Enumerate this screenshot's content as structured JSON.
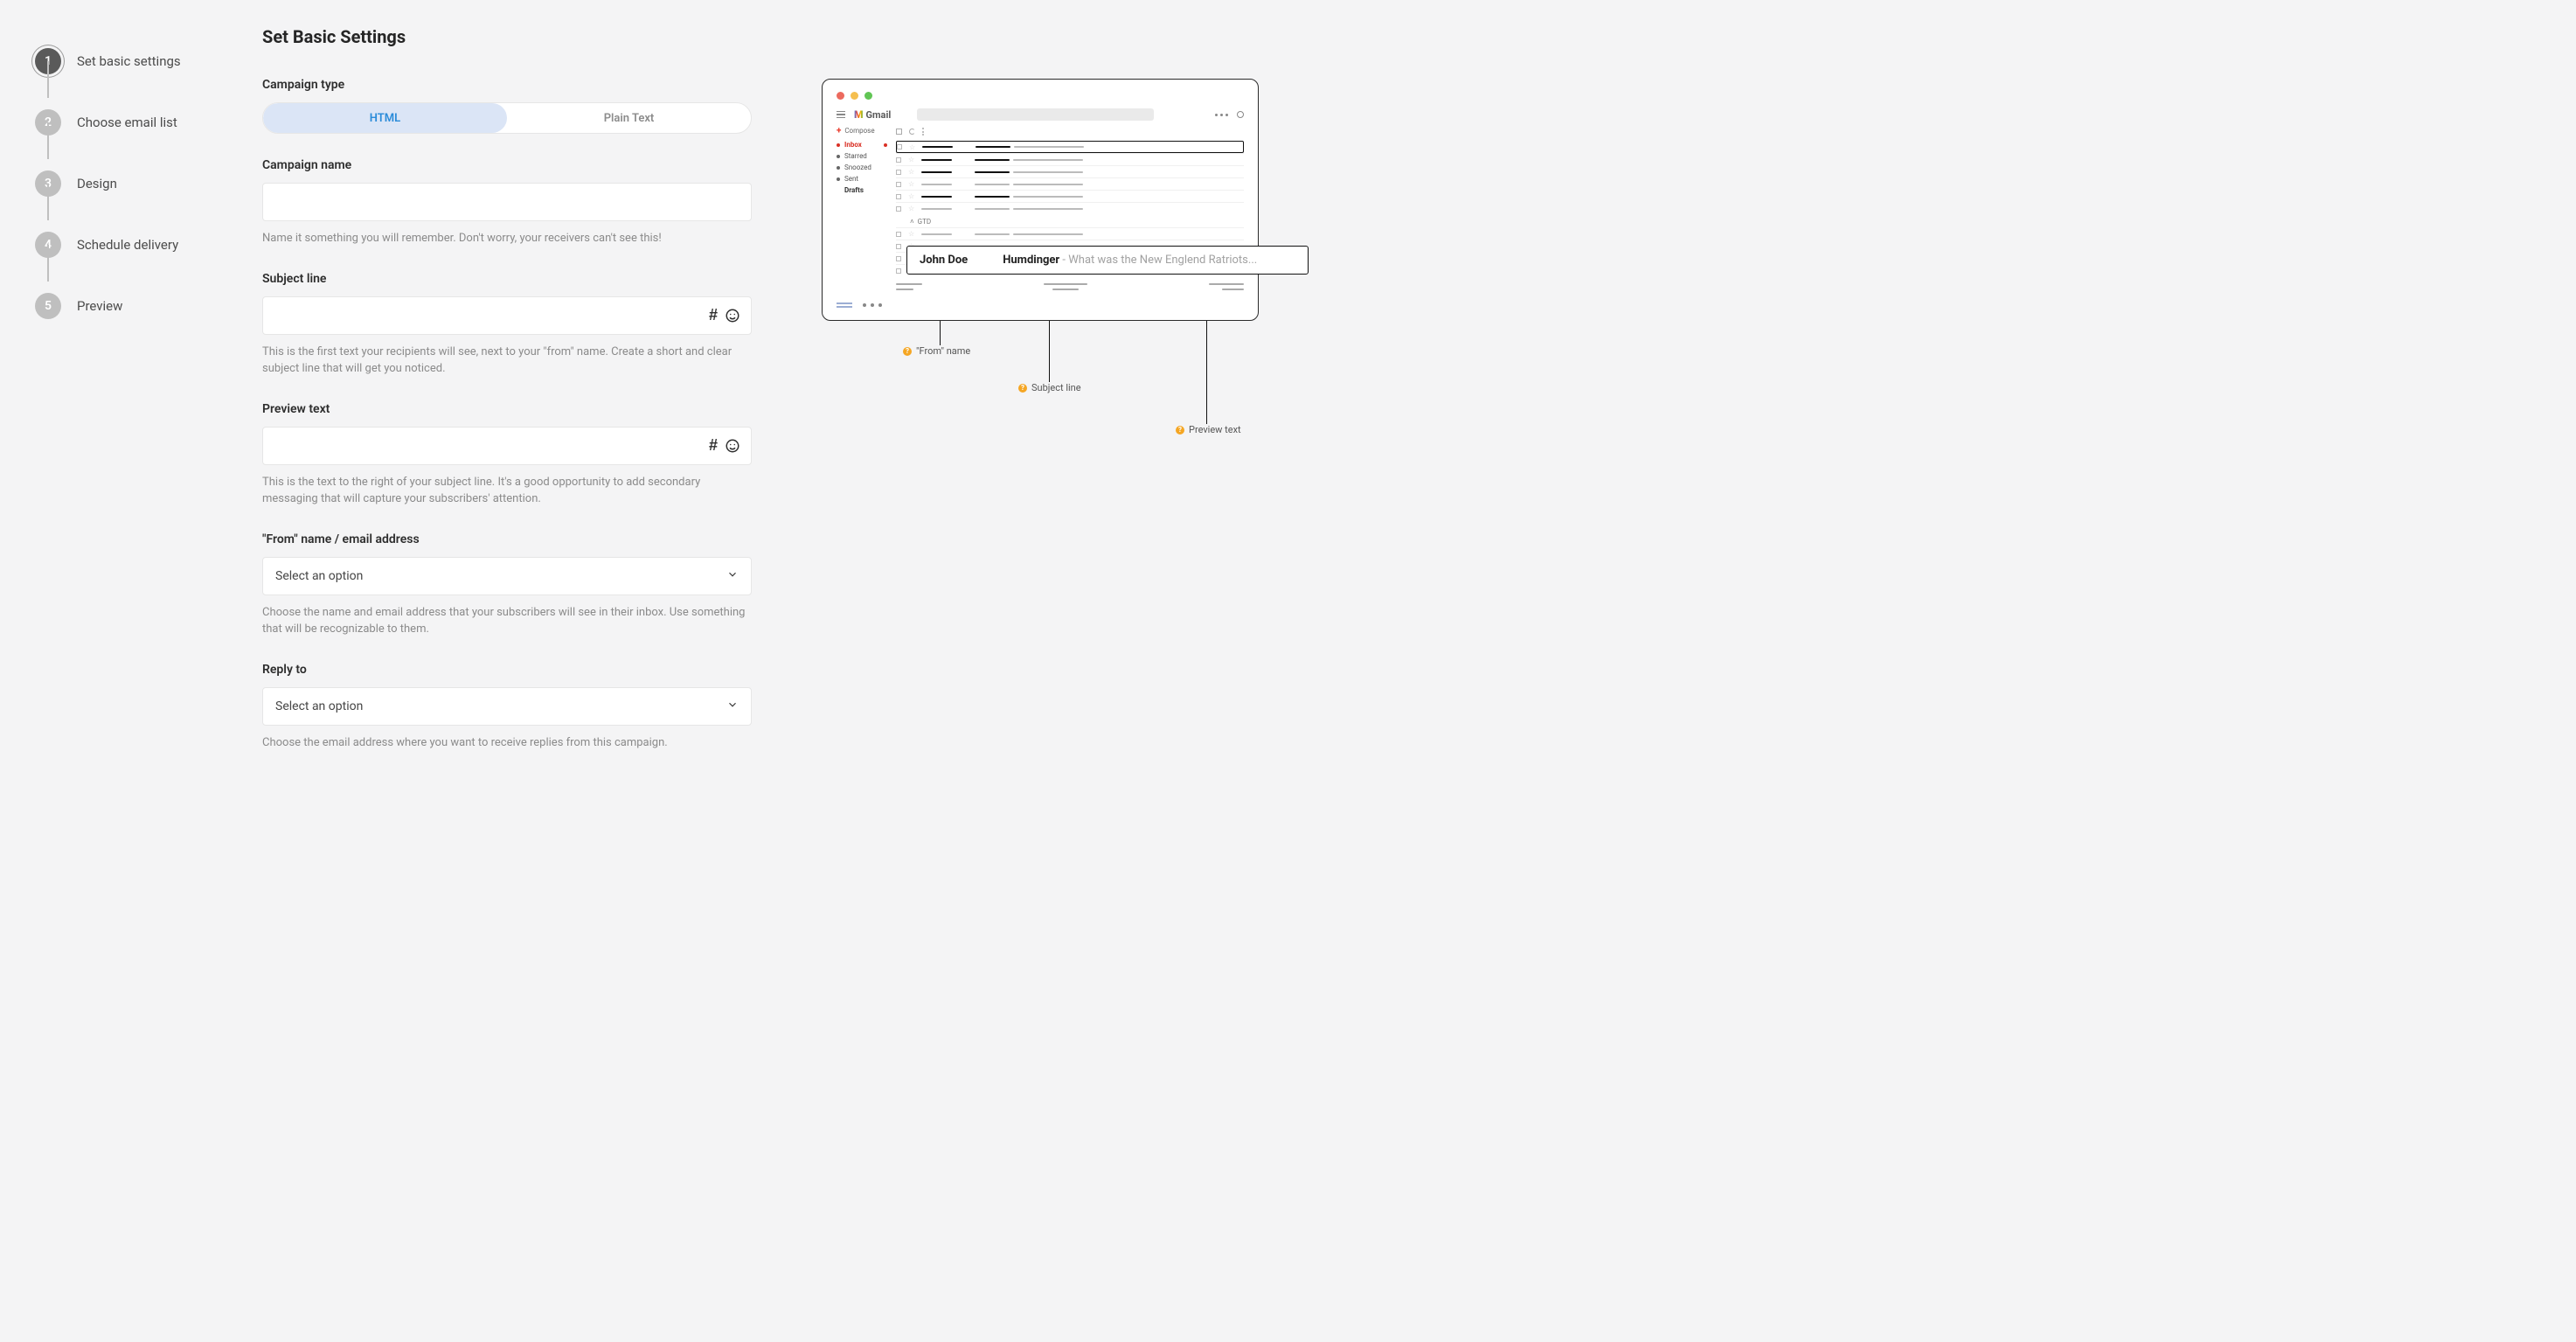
{
  "stepper": {
    "steps": [
      {
        "num": "1",
        "label": "Set basic settings",
        "active": true
      },
      {
        "num": "2",
        "label": "Choose email list"
      },
      {
        "num": "3",
        "label": "Design"
      },
      {
        "num": "4",
        "label": "Schedule delivery"
      },
      {
        "num": "5",
        "label": "Preview"
      }
    ]
  },
  "page": {
    "title": "Set Basic Settings"
  },
  "campaignType": {
    "label": "Campaign type",
    "options": {
      "html": "HTML",
      "plain": "Plain Text"
    },
    "selected": "html"
  },
  "campaignName": {
    "label": "Campaign name",
    "value": "",
    "help": "Name it something you will remember. Don't worry, your receivers can't see this!"
  },
  "subjectLine": {
    "label": "Subject line",
    "value": "",
    "help": "This is the first text your recipients will see, next to your \"from\" name. Create a short and clear subject line that will get you noticed."
  },
  "previewText": {
    "label": "Preview text",
    "value": "",
    "help": "This is the text to the right of your subject line. It's a good opportunity to add secondary messaging that will capture your subscribers' attention."
  },
  "fromName": {
    "label": "\"From\" name / email address",
    "placeholder": "Select an option",
    "help": "Choose the name and email address that your subscribers will see in their inbox. Use something that will be recognizable to them."
  },
  "replyTo": {
    "label": "Reply to",
    "placeholder": "Select an option",
    "help": "Choose the email address where you want to receive replies from this campaign."
  },
  "gmailPreview": {
    "appName": "Gmail",
    "compose": "Compose",
    "folders": {
      "inbox": "Inbox",
      "starred": "Starred",
      "snoozed": "Snoozed",
      "sent": "Sent",
      "drafts": "Drafts"
    },
    "gtd": "GTD",
    "sample": {
      "from": "John Doe",
      "subject": "Humdinger",
      "preview": " - What was the New Englend Ratriots..."
    },
    "annotations": {
      "from": "\"From\" name",
      "subject": "Subject line",
      "preview": "Preview text"
    }
  }
}
